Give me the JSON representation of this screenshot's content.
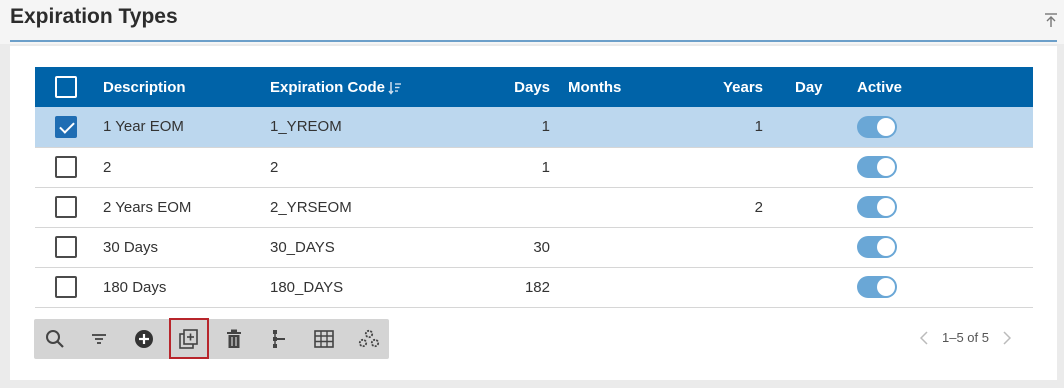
{
  "header": {
    "title": "Expiration Types"
  },
  "table": {
    "columns": [
      "Description",
      "Expiration Code",
      "Days",
      "Months",
      "Years",
      "Day",
      "Active"
    ],
    "rows": [
      {
        "selected": true,
        "description": "1 Year EOM",
        "code": "1_YREOM",
        "days": "1",
        "months": "",
        "years": "1",
        "day": "",
        "active": true
      },
      {
        "selected": false,
        "description": "2",
        "code": "2",
        "days": "1",
        "months": "",
        "years": "",
        "day": "",
        "active": true
      },
      {
        "selected": false,
        "description": "2 Years EOM",
        "code": "2_YRSEOM",
        "days": "",
        "months": "",
        "years": "2",
        "day": "",
        "active": true
      },
      {
        "selected": false,
        "description": "30 Days",
        "code": "30_DAYS",
        "days": "30",
        "months": "",
        "years": "",
        "day": "",
        "active": true
      },
      {
        "selected": false,
        "description": "180 Days",
        "code": "180_DAYS",
        "days": "182",
        "months": "",
        "years": "",
        "day": "",
        "active": true
      }
    ]
  },
  "toolbar": {
    "buttons": [
      "search-icon",
      "filter-icon",
      "add-circle-icon",
      "copy-add-icon",
      "trash-icon",
      "tree-icon",
      "grid-icon",
      "settings-icon"
    ]
  },
  "pager": {
    "text": "1–5 of 5"
  },
  "colors": {
    "header_bg": "#0063a8",
    "selected_row": "#bcd7ee",
    "toggle": "#6aa7d6",
    "accent_line": "#6c9fc9",
    "highlight": "#b8252b"
  }
}
